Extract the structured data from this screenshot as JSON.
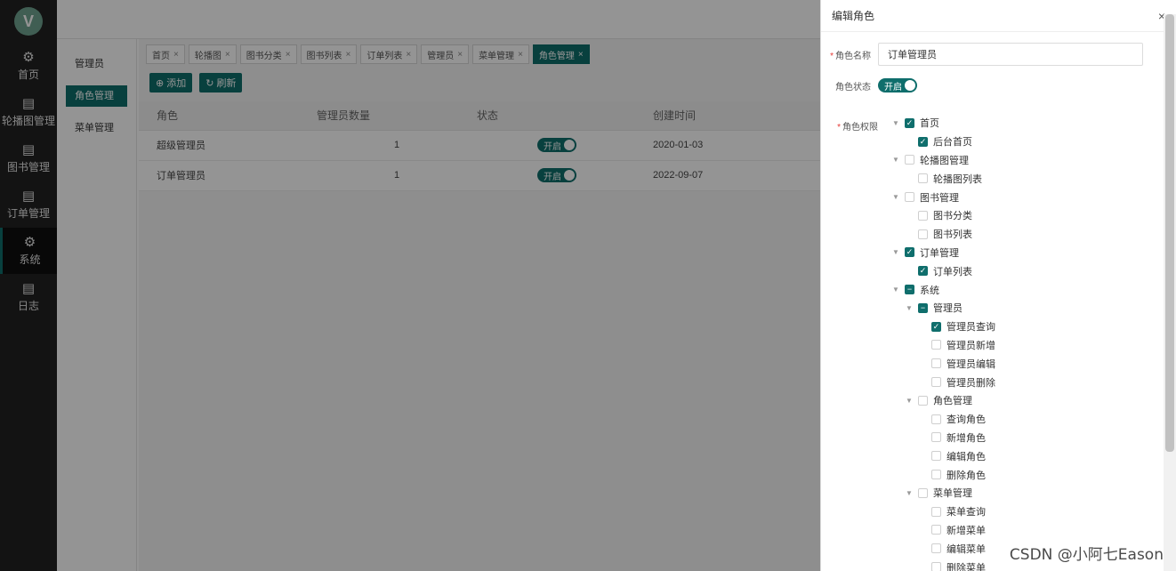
{
  "logo": {
    "letter": "V",
    "color": "#6fa38f"
  },
  "nav": {
    "items": [
      {
        "label": "首页",
        "icon": "gear-icon"
      },
      {
        "label": "轮播图管理",
        "icon": "clipboard-icon"
      },
      {
        "label": "图书管理",
        "icon": "clipboard-icon"
      },
      {
        "label": "订单管理",
        "icon": "clipboard-icon"
      },
      {
        "label": "系统",
        "icon": "gear-icon",
        "active": true
      },
      {
        "label": "日志",
        "icon": "clipboard-icon"
      }
    ]
  },
  "submenu": {
    "items": [
      {
        "label": "管理员"
      },
      {
        "label": "角色管理",
        "active": true
      },
      {
        "label": "菜单管理"
      }
    ]
  },
  "tabs": [
    {
      "label": "首页"
    },
    {
      "label": "轮播图"
    },
    {
      "label": "图书分类"
    },
    {
      "label": "图书列表"
    },
    {
      "label": "订单列表"
    },
    {
      "label": "管理员"
    },
    {
      "label": "菜单管理"
    },
    {
      "label": "角色管理",
      "active": true
    }
  ],
  "toolbar": {
    "add_label": "添加",
    "refresh_label": "刷新"
  },
  "table": {
    "headers": {
      "role": "角色",
      "count": "管理员数量",
      "status": "状态",
      "time": "创建时间"
    },
    "rows": [
      {
        "role": "超级管理员",
        "count": "1",
        "status": "开启",
        "time": "2020-01-03"
      },
      {
        "role": "订单管理员",
        "count": "1",
        "status": "开启",
        "time": "2022-09-07"
      }
    ]
  },
  "drawer": {
    "title": "编辑角色",
    "name_label": "角色名称",
    "name_value": "订单管理员",
    "status_label": "角色状态",
    "status_value": "开启",
    "perm_label": "角色权限"
  },
  "tree": [
    {
      "label": "首页",
      "level": 0,
      "state": "checked",
      "arrow": true
    },
    {
      "label": "后台首页",
      "level": 1,
      "state": "checked",
      "arrow": false
    },
    {
      "label": "轮播图管理",
      "level": 0,
      "state": "unchecked",
      "arrow": true
    },
    {
      "label": "轮播图列表",
      "level": 1,
      "state": "unchecked",
      "arrow": false
    },
    {
      "label": "图书管理",
      "level": 0,
      "state": "unchecked",
      "arrow": true
    },
    {
      "label": "图书分类",
      "level": 1,
      "state": "unchecked",
      "arrow": false
    },
    {
      "label": "图书列表",
      "level": 1,
      "state": "unchecked",
      "arrow": false
    },
    {
      "label": "订单管理",
      "level": 0,
      "state": "checked",
      "arrow": true
    },
    {
      "label": "订单列表",
      "level": 1,
      "state": "checked",
      "arrow": false
    },
    {
      "label": "系统",
      "level": 0,
      "state": "partial",
      "arrow": true
    },
    {
      "label": "管理员",
      "level": 1,
      "state": "partial",
      "arrow": true
    },
    {
      "label": "管理员查询",
      "level": 2,
      "state": "checked",
      "arrow": false
    },
    {
      "label": "管理员新增",
      "level": 2,
      "state": "unchecked",
      "arrow": false
    },
    {
      "label": "管理员编辑",
      "level": 2,
      "state": "unchecked",
      "arrow": false
    },
    {
      "label": "管理员删除",
      "level": 2,
      "state": "unchecked",
      "arrow": false
    },
    {
      "label": "角色管理",
      "level": 1,
      "state": "unchecked",
      "arrow": true
    },
    {
      "label": "查询角色",
      "level": 2,
      "state": "unchecked",
      "arrow": false
    },
    {
      "label": "新增角色",
      "level": 2,
      "state": "unchecked",
      "arrow": false
    },
    {
      "label": "编辑角色",
      "level": 2,
      "state": "unchecked",
      "arrow": false
    },
    {
      "label": "删除角色",
      "level": 2,
      "state": "unchecked",
      "arrow": false
    },
    {
      "label": "菜单管理",
      "level": 1,
      "state": "unchecked",
      "arrow": true
    },
    {
      "label": "菜单查询",
      "level": 2,
      "state": "unchecked",
      "arrow": false
    },
    {
      "label": "新增菜单",
      "level": 2,
      "state": "unchecked",
      "arrow": false
    },
    {
      "label": "编辑菜单",
      "level": 2,
      "state": "unchecked",
      "arrow": false
    },
    {
      "label": "删除菜单",
      "level": 2,
      "state": "unchecked",
      "arrow": false
    }
  ],
  "watermark": "CSDN @小阿七Eason",
  "colors": {
    "accent": "#0f6e6c",
    "nav_bg": "#222222",
    "required": "#e53935"
  }
}
